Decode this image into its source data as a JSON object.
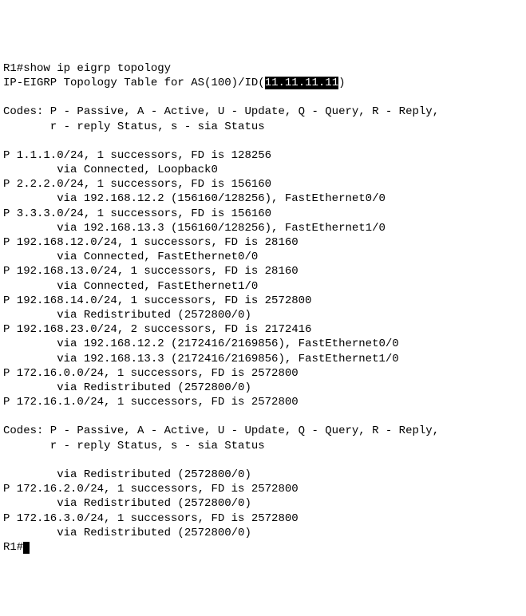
{
  "prompt1": "R1#",
  "command": "show ip eigrp topology",
  "header_prefix": "IP-EIGRP Topology Table for AS(",
  "as_num": "100",
  "header_mid": ")/ID(",
  "router_id": "11.11.11.11",
  "header_suffix": ")",
  "codes_line1": "Codes: P - Passive, A - Active, U - Update, Q - Query, R - Reply,",
  "codes_line2": "       r - reply Status, s - sia Status",
  "routes": [
    {
      "summary": "P 1.1.1.0/24, 1 successors, FD is 128256",
      "vias": [
        "        via Connected, Loopback0"
      ]
    },
    {
      "summary": "P 2.2.2.0/24, 1 successors, FD is 156160",
      "vias": [
        "        via 192.168.12.2 (156160/128256), FastEthernet0/0"
      ]
    },
    {
      "summary": "P 3.3.3.0/24, 1 successors, FD is 156160",
      "vias": [
        "        via 192.168.13.3 (156160/128256), FastEthernet1/0"
      ]
    },
    {
      "summary": "P 192.168.12.0/24, 1 successors, FD is 28160",
      "vias": [
        "        via Connected, FastEthernet0/0"
      ]
    },
    {
      "summary": "P 192.168.13.0/24, 1 successors, FD is 28160",
      "vias": [
        "        via Connected, FastEthernet1/0"
      ]
    },
    {
      "summary": "P 192.168.14.0/24, 1 successors, FD is 2572800",
      "vias": [
        "        via Redistributed (2572800/0)"
      ]
    },
    {
      "summary": "P 192.168.23.0/24, 2 successors, FD is 2172416",
      "vias": [
        "        via 192.168.12.2 (2172416/2169856), FastEthernet0/0",
        "        via 192.168.13.3 (2172416/2169856), FastEthernet1/0"
      ]
    },
    {
      "summary": "P 172.16.0.0/24, 1 successors, FD is 2572800",
      "vias": [
        "        via Redistributed (2572800/0)"
      ]
    },
    {
      "summary": "P 172.16.1.0/24, 1 successors, FD is 2572800",
      "vias": []
    }
  ],
  "continuation": {
    "via": "        via Redistributed (2572800/0)",
    "routes": [
      {
        "summary": "P 172.16.2.0/24, 1 successors, FD is 2572800",
        "vias": [
          "        via Redistributed (2572800/0)"
        ]
      },
      {
        "summary": "P 172.16.3.0/24, 1 successors, FD is 2572800",
        "vias": [
          "        via Redistributed (2572800/0)"
        ]
      }
    ]
  },
  "prompt2": "R1#"
}
